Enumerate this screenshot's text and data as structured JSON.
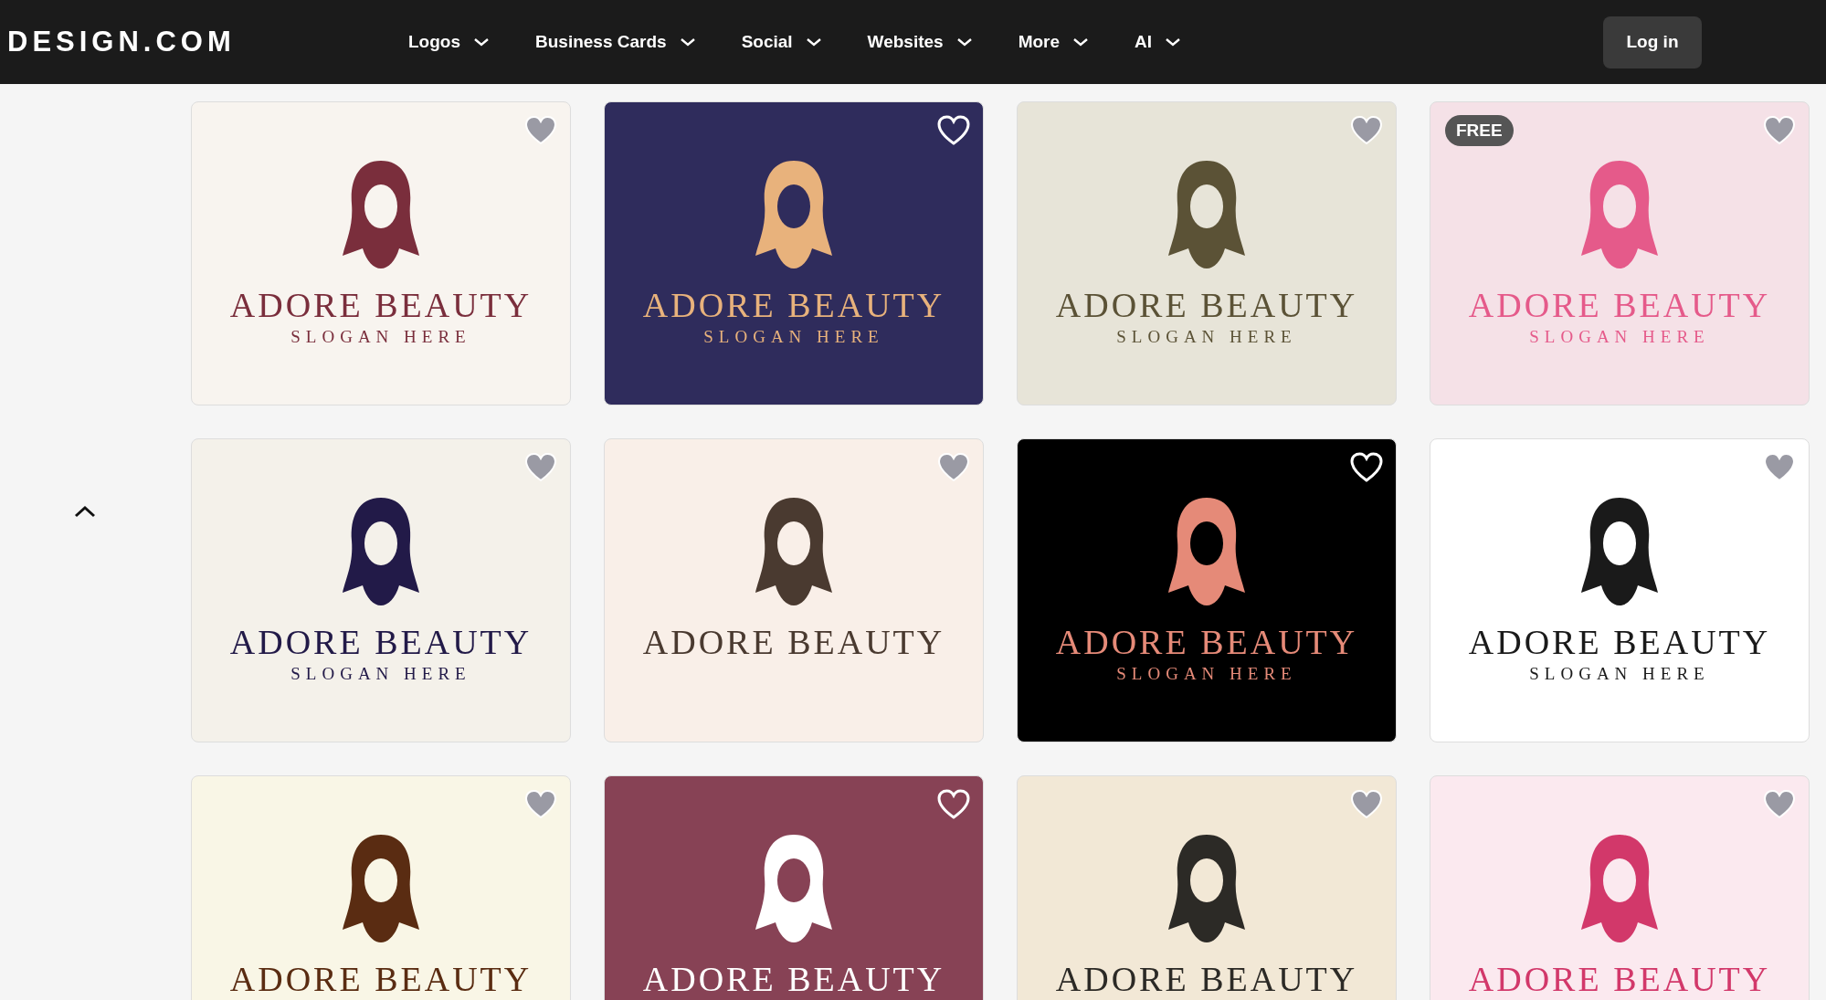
{
  "header": {
    "logo": "DESIGN.COM",
    "nav": [
      {
        "label": "Logos"
      },
      {
        "label": "Business Cards"
      },
      {
        "label": "Social"
      },
      {
        "label": "Websites"
      },
      {
        "label": "More"
      },
      {
        "label": "AI"
      }
    ],
    "login": "Log in"
  },
  "cards": [
    {
      "title": "ADORE BEAUTY",
      "slogan": "SLOGAN HERE",
      "color": "#f8f4ef",
      "logo": {
        "color": "#7a2e3c"
      },
      "kind": "light"
    },
    {
      "title": "ADORE BEAUTY",
      "slogan": "SLOGAN HERE",
      "color": "#2f2c5c",
      "logo": {
        "color": "#e8b27c"
      },
      "kind": "dark"
    },
    {
      "title": "ADORE BEAUTY",
      "slogan": "SLOGAN HERE",
      "color": "#e7e4d8",
      "logo": {
        "color": "#5b5236"
      },
      "kind": "light"
    },
    {
      "title": "ADORE BEAUTY",
      "slogan": "SLOGAN HERE",
      "color": "#f5e1e7",
      "logo": {
        "color": "#e55a8a"
      },
      "kind": "light",
      "badge": "FREE"
    },
    {
      "title": "ADORE BEAUTY",
      "slogan": "SLOGAN HERE",
      "color": "#f4f1ea",
      "logo": {
        "color": "#221a48"
      },
      "kind": "light"
    },
    {
      "title": "ADORE BEAUTY",
      "color": "#f9efe8",
      "logo": {
        "color": "#4a3a30"
      },
      "kind": "light"
    },
    {
      "title": "ADORE BEAUTY",
      "slogan": "SLOGAN HERE",
      "color": "#000000",
      "logo": {
        "color": "#e58a78"
      },
      "kind": "dark"
    },
    {
      "title": "ADORE BEAUTY",
      "slogan": "SLOGAN HERE",
      "color": "#ffffff",
      "logo": {
        "color": "#1a1a1a"
      },
      "kind": "light"
    },
    {
      "title": "ADORE BEAUTY",
      "color": "#f9f6e6",
      "logo": {
        "color": "#5a2c12"
      },
      "kind": "light"
    },
    {
      "title": "ADORE BEAUTY",
      "color": "#874255",
      "logo": {
        "color": "#ffffff"
      },
      "kind": "dark"
    },
    {
      "title": "ADORE BEAUTY",
      "color": "#f2e8d6",
      "logo": {
        "color": "#2c2a26"
      },
      "kind": "light"
    },
    {
      "title": "ADORE BEAUTY",
      "color": "#fbe9ef",
      "logo": {
        "color": "#d2386a"
      },
      "kind": "light"
    }
  ]
}
